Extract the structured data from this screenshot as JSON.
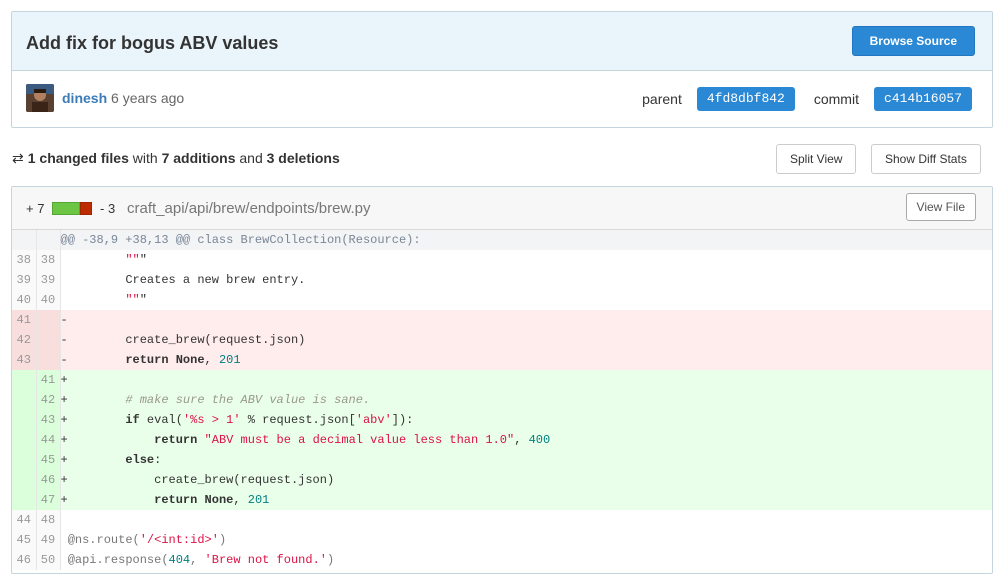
{
  "commit": {
    "title": "Add fix for bogus ABV values",
    "browse_source": "Browse Source",
    "author": "dinesh",
    "time": "6 years ago",
    "parent_label": "parent",
    "parent_sha": "4fd8dbf842",
    "commit_label": "commit",
    "commit_sha": "c414b16057"
  },
  "summary": {
    "changed_files": "1 changed files",
    "with": "with",
    "additions": "7 additions",
    "and": "and",
    "deletions": "3 deletions",
    "split_view": "Split View",
    "show_diff_stats": "Show Diff Stats"
  },
  "file": {
    "additions": "+ 7",
    "deletions": "- 3",
    "path": "craft_api/api/brew/endpoints/brew.py",
    "view_file": "View File",
    "hunk": "@@ -38,9 +38,13 @@ class BrewCollection(Resource):"
  },
  "colors": {
    "primary": "#2a88d4",
    "header_bg": "#eaf4fb",
    "addition_bg": "#eaffea",
    "deletion_bg": "#ffecec",
    "stat_add": "#6cc644",
    "stat_del": "#bd2c00"
  },
  "lines": [
    {
      "type": "ctx",
      "old": "38",
      "new": "38",
      "sign": " ",
      "code": "        \"\"\""
    },
    {
      "type": "ctx",
      "old": "39",
      "new": "39",
      "sign": " ",
      "code": "        Creates a new brew entry."
    },
    {
      "type": "ctx",
      "old": "40",
      "new": "40",
      "sign": " ",
      "code": "        \"\"\""
    },
    {
      "type": "del",
      "old": "41",
      "new": "",
      "sign": "-",
      "code": ""
    },
    {
      "type": "del",
      "old": "42",
      "new": "",
      "sign": "-",
      "code": "        create_brew(request.json)"
    },
    {
      "type": "del",
      "old": "43",
      "new": "",
      "sign": "-",
      "code": "        return None, 201"
    },
    {
      "type": "add",
      "old": "",
      "new": "41",
      "sign": "+",
      "code": ""
    },
    {
      "type": "add",
      "old": "",
      "new": "42",
      "sign": "+",
      "code": "        # make sure the ABV value is sane."
    },
    {
      "type": "add",
      "old": "",
      "new": "43",
      "sign": "+",
      "code": "        if eval('%s > 1' % request.json['abv']):"
    },
    {
      "type": "add",
      "old": "",
      "new": "44",
      "sign": "+",
      "code": "            return \"ABV must be a decimal value less than 1.0\", 400"
    },
    {
      "type": "add",
      "old": "",
      "new": "45",
      "sign": "+",
      "code": "        else:"
    },
    {
      "type": "add",
      "old": "",
      "new": "46",
      "sign": "+",
      "code": "            create_brew(request.json)"
    },
    {
      "type": "add",
      "old": "",
      "new": "47",
      "sign": "+",
      "code": "            return None, 201"
    },
    {
      "type": "ctx",
      "old": "44",
      "new": "48",
      "sign": " ",
      "code": ""
    },
    {
      "type": "ctx-dim",
      "old": "45",
      "new": "49",
      "sign": " ",
      "code": "@ns.route('/<int:id>')"
    },
    {
      "type": "ctx-dim",
      "old": "46",
      "new": "50",
      "sign": " ",
      "code": "@api.response(404, 'Brew not found.')"
    }
  ]
}
